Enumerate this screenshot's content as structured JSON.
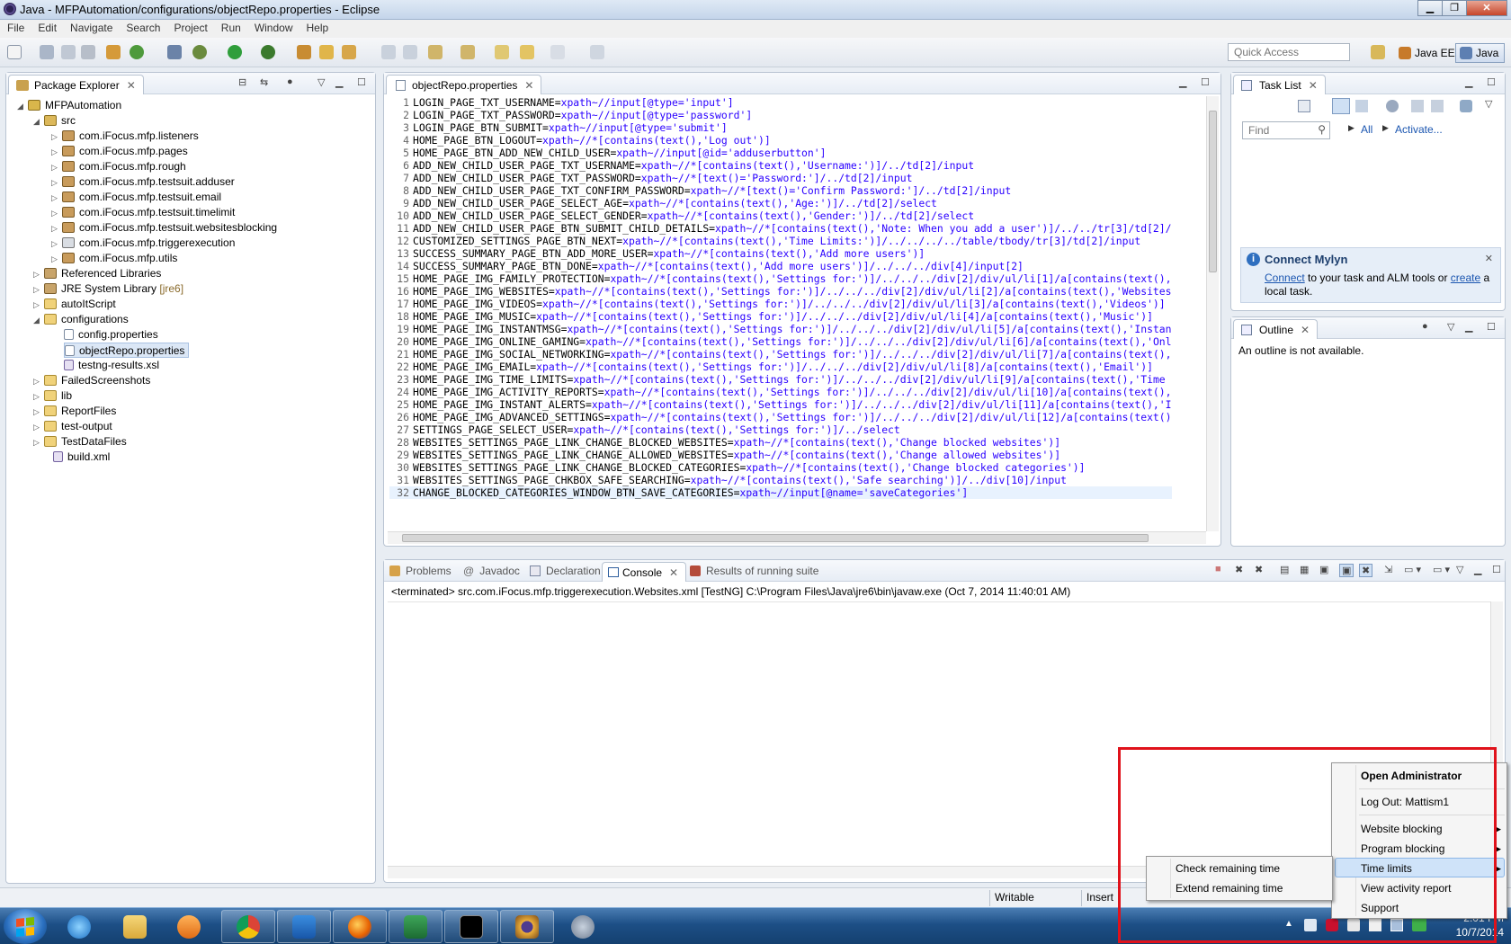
{
  "window": {
    "title": "Java - MFPAutomation/configurations/objectRepo.properties - Eclipse",
    "min": "▁",
    "max": "❐",
    "close": "✕"
  },
  "menu": [
    "File",
    "Edit",
    "Navigate",
    "Search",
    "Project",
    "Run",
    "Window",
    "Help"
  ],
  "quick_access": {
    "placeholder": "Quick Access"
  },
  "perspectives": [
    {
      "label": "Java EE"
    },
    {
      "label": "Java"
    }
  ],
  "package_explorer": {
    "title": "Package Explorer",
    "items": [
      {
        "label": "MFPAutomation",
        "icon": "project-icon"
      },
      {
        "label": "src",
        "icon": "source-folder-icon"
      },
      {
        "label": "com.iFocus.mfp.listeners",
        "icon": "package-icon"
      },
      {
        "label": "com.iFocus.mfp.pages",
        "icon": "package-icon"
      },
      {
        "label": "com.iFocus.mfp.rough",
        "icon": "package-icon"
      },
      {
        "label": "com.iFocus.mfp.testsuit.adduser",
        "icon": "package-icon"
      },
      {
        "label": "com.iFocus.mfp.testsuit.email",
        "icon": "package-icon"
      },
      {
        "label": "com.iFocus.mfp.testsuit.timelimit",
        "icon": "package-icon"
      },
      {
        "label": "com.iFocus.mfp.testsuit.websitesblocking",
        "icon": "package-icon"
      },
      {
        "label": "com.iFocus.mfp.triggerexecution",
        "icon": "package-icon"
      },
      {
        "label": "com.iFocus.mfp.utils",
        "icon": "package-icon"
      },
      {
        "label": "Referenced Libraries",
        "icon": "library-icon"
      },
      {
        "label": "JRE System Library",
        "extra": "[jre6]",
        "icon": "library-icon"
      },
      {
        "label": "autoItScript",
        "icon": "folder-icon"
      },
      {
        "label": "configurations",
        "icon": "folder-icon"
      },
      {
        "label": "config.properties",
        "icon": "file-icon"
      },
      {
        "label": "objectRepo.properties",
        "icon": "file-icon"
      },
      {
        "label": "testng-results.xsl",
        "icon": "xsl-file-icon"
      },
      {
        "label": "FailedScreenshots",
        "icon": "folder-icon"
      },
      {
        "label": "lib",
        "icon": "folder-icon"
      },
      {
        "label": "ReportFiles",
        "icon": "folder-icon"
      },
      {
        "label": "test-output",
        "icon": "folder-icon"
      },
      {
        "label": "TestDataFiles",
        "icon": "folder-icon"
      },
      {
        "label": "build.xml",
        "icon": "xml-file-icon"
      }
    ]
  },
  "editor": {
    "tab": "objectRepo.properties",
    "lines": [
      {
        "n": "1",
        "k": "LOGIN_PAGE_TXT_USERNAME=",
        "v": "xpath~//input[@type='input']"
      },
      {
        "n": "2",
        "k": "LOGIN_PAGE_TXT_PASSWORD=",
        "v": "xpath~//input[@type='password']"
      },
      {
        "n": "3",
        "k": "LOGIN_PAGE_BTN_SUBMIT=",
        "v": "xpath~//input[@type='submit']"
      },
      {
        "n": "4",
        "k": "HOME_PAGE_BTN_LOGOUT=",
        "v": "xpath~//*[contains(text(),'Log out')]"
      },
      {
        "n": "5",
        "k": "HOME_PAGE_BTN_ADD_NEW_CHILD_USER=",
        "v": "xpath~//input[@id='adduserbutton']"
      },
      {
        "n": "6",
        "k": "ADD_NEW_CHILD_USER_PAGE_TXT_USERNAME=",
        "v": "xpath~//*[contains(text(),'Username:')]/../td[2]/input"
      },
      {
        "n": "7",
        "k": "ADD_NEW_CHILD_USER_PAGE_TXT_PASSWORD=",
        "v": "xpath~//*[text()='Password:']/../td[2]/input"
      },
      {
        "n": "8",
        "k": "ADD_NEW_CHILD_USER_PAGE_TXT_CONFIRM_PASSWORD=",
        "v": "xpath~//*[text()='Confirm Password:']/../td[2]/input"
      },
      {
        "n": "9",
        "k": "ADD_NEW_CHILD_USER_PAGE_SELECT_AGE=",
        "v": "xpath~//*[contains(text(),'Age:')]/../td[2]/select"
      },
      {
        "n": "10",
        "k": "ADD_NEW_CHILD_USER_PAGE_SELECT_GENDER=",
        "v": "xpath~//*[contains(text(),'Gender:')]/../td[2]/select"
      },
      {
        "n": "11",
        "k": "ADD_NEW_CHILD_USER_PAGE_BTN_SUBMIT_CHILD_DETAILS=",
        "v": "xpath~//*[contains(text(),'Note: When you add a user')]/../../tr[3]/td[2]/"
      },
      {
        "n": "12",
        "k": "CUSTOMIZED_SETTINGS_PAGE_BTN_NEXT=",
        "v": "xpath~//*[contains(text(),'Time Limits:')]/../../../../table/tbody/tr[3]/td[2]/input"
      },
      {
        "n": "13",
        "k": "SUCCESS_SUMMARY_PAGE_BTN_ADD_MORE_USER=",
        "v": "xpath~//*[contains(text(),'Add more users')]"
      },
      {
        "n": "14",
        "k": "SUCCESS_SUMMARY_PAGE_BTN_DONE=",
        "v": "xpath~//*[contains(text(),'Add more users')]/../../../div[4]/input[2]"
      },
      {
        "n": "15",
        "k": "HOME_PAGE_IMG_FAMILY_PROTECTION=",
        "v": "xpath~//*[contains(text(),'Settings for:')]/../../../div[2]/div/ul/li[1]/a[contains(text(),"
      },
      {
        "n": "16",
        "k": "HOME_PAGE_IMG_WEBSITES=",
        "v": "xpath~//*[contains(text(),'Settings for:')]/../../../div[2]/div/ul/li[2]/a[contains(text(),'Websites"
      },
      {
        "n": "17",
        "k": "HOME_PAGE_IMG_VIDEOS=",
        "v": "xpath~//*[contains(text(),'Settings for:')]/../../../div[2]/div/ul/li[3]/a[contains(text(),'Videos')]"
      },
      {
        "n": "18",
        "k": "HOME_PAGE_IMG_MUSIC=",
        "v": "xpath~//*[contains(text(),'Settings for:')]/../../../div[2]/div/ul/li[4]/a[contains(text(),'Music')]"
      },
      {
        "n": "19",
        "k": "HOME_PAGE_IMG_INSTANTMSG=",
        "v": "xpath~//*[contains(text(),'Settings for:')]/../../../div[2]/div/ul/li[5]/a[contains(text(),'Instan"
      },
      {
        "n": "20",
        "k": "HOME_PAGE_IMG_ONLINE_GAMING=",
        "v": "xpath~//*[contains(text(),'Settings for:')]/../../../div[2]/div/ul/li[6]/a[contains(text(),'Onl"
      },
      {
        "n": "21",
        "k": "HOME_PAGE_IMG_SOCIAL_NETWORKING=",
        "v": "xpath~//*[contains(text(),'Settings for:')]/../../../div[2]/div/ul/li[7]/a[contains(text(),"
      },
      {
        "n": "22",
        "k": "HOME_PAGE_IMG_EMAIL=",
        "v": "xpath~//*[contains(text(),'Settings for:')]/../../../div[2]/div/ul/li[8]/a[contains(text(),'Email')]"
      },
      {
        "n": "23",
        "k": "HOME_PAGE_IMG_TIME_LIMITS=",
        "v": "xpath~//*[contains(text(),'Settings for:')]/../../../div[2]/div/ul/li[9]/a[contains(text(),'Time "
      },
      {
        "n": "24",
        "k": "HOME_PAGE_IMG_ACTIVITY_REPORTS=",
        "v": "xpath~//*[contains(text(),'Settings for:')]/../../../div[2]/div/ul/li[10]/a[contains(text(),"
      },
      {
        "n": "25",
        "k": "HOME_PAGE_IMG_INSTANT_ALERTS=",
        "v": "xpath~//*[contains(text(),'Settings for:')]/../../../div[2]/div/ul/li[11]/a[contains(text(),'I"
      },
      {
        "n": "26",
        "k": "HOME_PAGE_IMG_ADVANCED_SETTINGS=",
        "v": "xpath~//*[contains(text(),'Settings for:')]/../../../div[2]/div/ul/li[12]/a[contains(text()"
      },
      {
        "n": "27",
        "k": "SETTINGS_PAGE_SELECT_USER=",
        "v": "xpath~//*[contains(text(),'Settings for:')]/../select"
      },
      {
        "n": "28",
        "k": "WEBSITES_SETTINGS_PAGE_LINK_CHANGE_BLOCKED_WEBSITES=",
        "v": "xpath~//*[contains(text(),'Change blocked websites')]"
      },
      {
        "n": "29",
        "k": "WEBSITES_SETTINGS_PAGE_LINK_CHANGE_ALLOWED_WEBSITES=",
        "v": "xpath~//*[contains(text(),'Change allowed websites')]"
      },
      {
        "n": "30",
        "k": "WEBSITES_SETTINGS_PAGE_LINK_CHANGE_BLOCKED_CATEGORIES=",
        "v": "xpath~//*[contains(text(),'Change blocked categories')]"
      },
      {
        "n": "31",
        "k": "WEBSITES_SETTINGS_PAGE_CHKBOX_SAFE_SEARCHING=",
        "v": "xpath~//*[contains(text(),'Safe searching')]/../div[10]/input"
      },
      {
        "n": "32",
        "k": "CHANGE_BLOCKED_CATEGORIES_WINDOW_BTN_SAVE_CATEGORIES=",
        "v": "xpath~//input[@name='saveCategories']"
      }
    ]
  },
  "task_list": {
    "title": "Task List",
    "find_placeholder": "Find",
    "all": "All",
    "activate": "Activate..."
  },
  "mylyn": {
    "title": "Connect Mylyn",
    "connect": "Connect",
    "text1": " to your task and ALM tools or ",
    "create": "create",
    "text2": " a",
    "text3": "local task."
  },
  "outline": {
    "title": "Outline",
    "message": "An outline is not available."
  },
  "bottom_tabs": [
    {
      "label": "Problems"
    },
    {
      "label": "Javadoc"
    },
    {
      "label": "Declaration"
    },
    {
      "label": "Console"
    },
    {
      "label": "Results of running suite"
    }
  ],
  "console": {
    "status": "<terminated> src.com.iFocus.mfp.triggerexecution.Websites.xml [TestNG] C:\\Program Files\\Java\\jre6\\bin\\javaw.exe (Oct 7, 2014 11:40:01 AM)"
  },
  "statusbar": {
    "writable": "Writable",
    "insert": "Insert"
  },
  "context_menu": {
    "items": [
      {
        "label": "Open Administrator",
        "bold": true
      },
      {
        "label": "Log Out: Mattism1"
      },
      {
        "label": "Website blocking",
        "arrow": true
      },
      {
        "label": "Program blocking",
        "arrow": true
      },
      {
        "label": "Time limits",
        "arrow": true,
        "highlight": true
      },
      {
        "label": "View activity report"
      },
      {
        "label": "Support"
      }
    ],
    "submenu": [
      {
        "label": "Check remaining time"
      },
      {
        "label": "Extend remaining time"
      }
    ]
  },
  "taskbar": {
    "time": "2:01 PM",
    "date": "10/7/2014",
    "apps": [
      "ie-icon",
      "explorer-icon",
      "media-player-icon",
      "chrome-icon",
      "outlook-icon",
      "firefox-icon",
      "excel-icon",
      "cmd-icon",
      "eclipse-icon",
      "app-icon"
    ]
  },
  "colors": {
    "accent": "#2a00ff",
    "highlight": "#cfe3f9",
    "redbox": "#e0121b"
  }
}
